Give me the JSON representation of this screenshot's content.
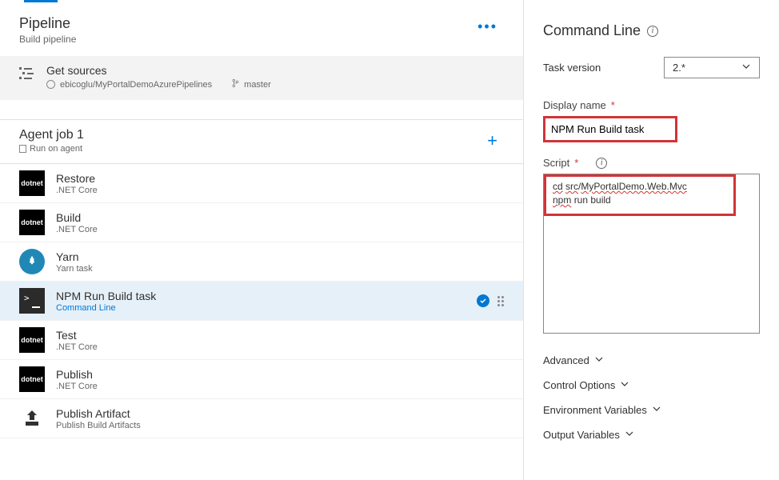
{
  "header": {
    "title": "Pipeline",
    "subtitle": "Build pipeline"
  },
  "sources": {
    "title": "Get sources",
    "repo": "ebicoglu/MyPortalDemoAzurePipelines",
    "branch": "master"
  },
  "agent_job": {
    "title": "Agent job 1",
    "subtitle": "Run on agent"
  },
  "tasks": [
    {
      "name": "Restore",
      "sub": ".NET Core",
      "icon": "dotnet"
    },
    {
      "name": "Build",
      "sub": ".NET Core",
      "icon": "dotnet"
    },
    {
      "name": "Yarn",
      "sub": "Yarn task",
      "icon": "yarn"
    },
    {
      "name": "NPM Run Build task",
      "sub": "Command Line",
      "icon": "cli",
      "selected": true
    },
    {
      "name": "Test",
      "sub": ".NET Core",
      "icon": "dotnet"
    },
    {
      "name": "Publish",
      "sub": ".NET Core",
      "icon": "dotnet"
    },
    {
      "name": "Publish Artifact",
      "sub": "Publish Build Artifacts",
      "icon": "artifact"
    }
  ],
  "panel": {
    "title": "Command Line",
    "task_version_label": "Task version",
    "task_version_value": "2.*",
    "display_name_label": "Display name",
    "display_name_value": "NPM Run Build task",
    "script_label": "Script",
    "script_line1_a": "cd",
    "script_line1_b": "src",
    "script_line1_c": "MyPortalDemo.Web.Mvc",
    "script_line2_a": "npm",
    "script_line2_b": "run build",
    "sections": {
      "advanced": "Advanced",
      "control": "Control Options",
      "env": "Environment Variables",
      "output": "Output Variables"
    }
  }
}
